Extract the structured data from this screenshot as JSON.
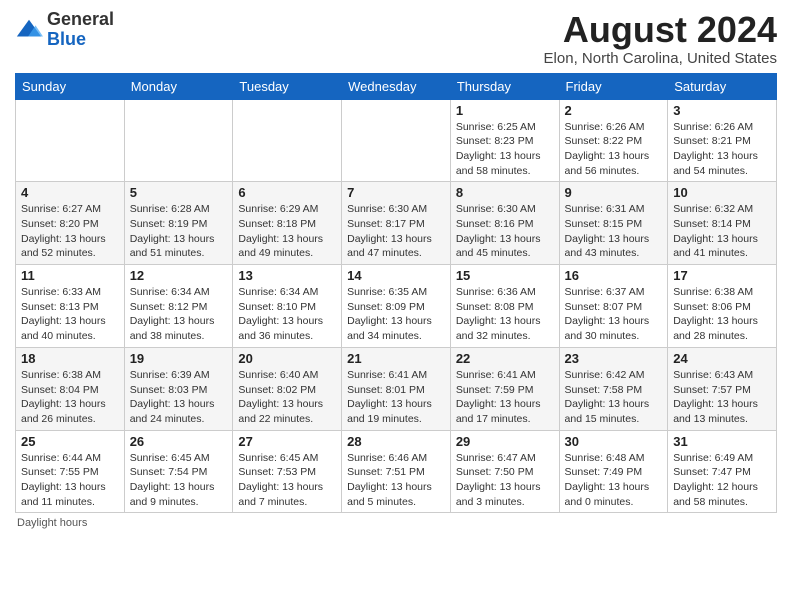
{
  "header": {
    "logo_line1": "General",
    "logo_line2": "Blue",
    "month": "August 2024",
    "location": "Elon, North Carolina, United States"
  },
  "days_of_week": [
    "Sunday",
    "Monday",
    "Tuesday",
    "Wednesday",
    "Thursday",
    "Friday",
    "Saturday"
  ],
  "weeks": [
    [
      {
        "num": "",
        "info": ""
      },
      {
        "num": "",
        "info": ""
      },
      {
        "num": "",
        "info": ""
      },
      {
        "num": "",
        "info": ""
      },
      {
        "num": "1",
        "info": "Sunrise: 6:25 AM\nSunset: 8:23 PM\nDaylight: 13 hours\nand 58 minutes."
      },
      {
        "num": "2",
        "info": "Sunrise: 6:26 AM\nSunset: 8:22 PM\nDaylight: 13 hours\nand 56 minutes."
      },
      {
        "num": "3",
        "info": "Sunrise: 6:26 AM\nSunset: 8:21 PM\nDaylight: 13 hours\nand 54 minutes."
      }
    ],
    [
      {
        "num": "4",
        "info": "Sunrise: 6:27 AM\nSunset: 8:20 PM\nDaylight: 13 hours\nand 52 minutes."
      },
      {
        "num": "5",
        "info": "Sunrise: 6:28 AM\nSunset: 8:19 PM\nDaylight: 13 hours\nand 51 minutes."
      },
      {
        "num": "6",
        "info": "Sunrise: 6:29 AM\nSunset: 8:18 PM\nDaylight: 13 hours\nand 49 minutes."
      },
      {
        "num": "7",
        "info": "Sunrise: 6:30 AM\nSunset: 8:17 PM\nDaylight: 13 hours\nand 47 minutes."
      },
      {
        "num": "8",
        "info": "Sunrise: 6:30 AM\nSunset: 8:16 PM\nDaylight: 13 hours\nand 45 minutes."
      },
      {
        "num": "9",
        "info": "Sunrise: 6:31 AM\nSunset: 8:15 PM\nDaylight: 13 hours\nand 43 minutes."
      },
      {
        "num": "10",
        "info": "Sunrise: 6:32 AM\nSunset: 8:14 PM\nDaylight: 13 hours\nand 41 minutes."
      }
    ],
    [
      {
        "num": "11",
        "info": "Sunrise: 6:33 AM\nSunset: 8:13 PM\nDaylight: 13 hours\nand 40 minutes."
      },
      {
        "num": "12",
        "info": "Sunrise: 6:34 AM\nSunset: 8:12 PM\nDaylight: 13 hours\nand 38 minutes."
      },
      {
        "num": "13",
        "info": "Sunrise: 6:34 AM\nSunset: 8:10 PM\nDaylight: 13 hours\nand 36 minutes."
      },
      {
        "num": "14",
        "info": "Sunrise: 6:35 AM\nSunset: 8:09 PM\nDaylight: 13 hours\nand 34 minutes."
      },
      {
        "num": "15",
        "info": "Sunrise: 6:36 AM\nSunset: 8:08 PM\nDaylight: 13 hours\nand 32 minutes."
      },
      {
        "num": "16",
        "info": "Sunrise: 6:37 AM\nSunset: 8:07 PM\nDaylight: 13 hours\nand 30 minutes."
      },
      {
        "num": "17",
        "info": "Sunrise: 6:38 AM\nSunset: 8:06 PM\nDaylight: 13 hours\nand 28 minutes."
      }
    ],
    [
      {
        "num": "18",
        "info": "Sunrise: 6:38 AM\nSunset: 8:04 PM\nDaylight: 13 hours\nand 26 minutes."
      },
      {
        "num": "19",
        "info": "Sunrise: 6:39 AM\nSunset: 8:03 PM\nDaylight: 13 hours\nand 24 minutes."
      },
      {
        "num": "20",
        "info": "Sunrise: 6:40 AM\nSunset: 8:02 PM\nDaylight: 13 hours\nand 22 minutes."
      },
      {
        "num": "21",
        "info": "Sunrise: 6:41 AM\nSunset: 8:01 PM\nDaylight: 13 hours\nand 19 minutes."
      },
      {
        "num": "22",
        "info": "Sunrise: 6:41 AM\nSunset: 7:59 PM\nDaylight: 13 hours\nand 17 minutes."
      },
      {
        "num": "23",
        "info": "Sunrise: 6:42 AM\nSunset: 7:58 PM\nDaylight: 13 hours\nand 15 minutes."
      },
      {
        "num": "24",
        "info": "Sunrise: 6:43 AM\nSunset: 7:57 PM\nDaylight: 13 hours\nand 13 minutes."
      }
    ],
    [
      {
        "num": "25",
        "info": "Sunrise: 6:44 AM\nSunset: 7:55 PM\nDaylight: 13 hours\nand 11 minutes."
      },
      {
        "num": "26",
        "info": "Sunrise: 6:45 AM\nSunset: 7:54 PM\nDaylight: 13 hours\nand 9 minutes."
      },
      {
        "num": "27",
        "info": "Sunrise: 6:45 AM\nSunset: 7:53 PM\nDaylight: 13 hours\nand 7 minutes."
      },
      {
        "num": "28",
        "info": "Sunrise: 6:46 AM\nSunset: 7:51 PM\nDaylight: 13 hours\nand 5 minutes."
      },
      {
        "num": "29",
        "info": "Sunrise: 6:47 AM\nSunset: 7:50 PM\nDaylight: 13 hours\nand 3 minutes."
      },
      {
        "num": "30",
        "info": "Sunrise: 6:48 AM\nSunset: 7:49 PM\nDaylight: 13 hours\nand 0 minutes."
      },
      {
        "num": "31",
        "info": "Sunrise: 6:49 AM\nSunset: 7:47 PM\nDaylight: 12 hours\nand 58 minutes."
      }
    ]
  ],
  "footer": {
    "note": "Daylight hours"
  }
}
